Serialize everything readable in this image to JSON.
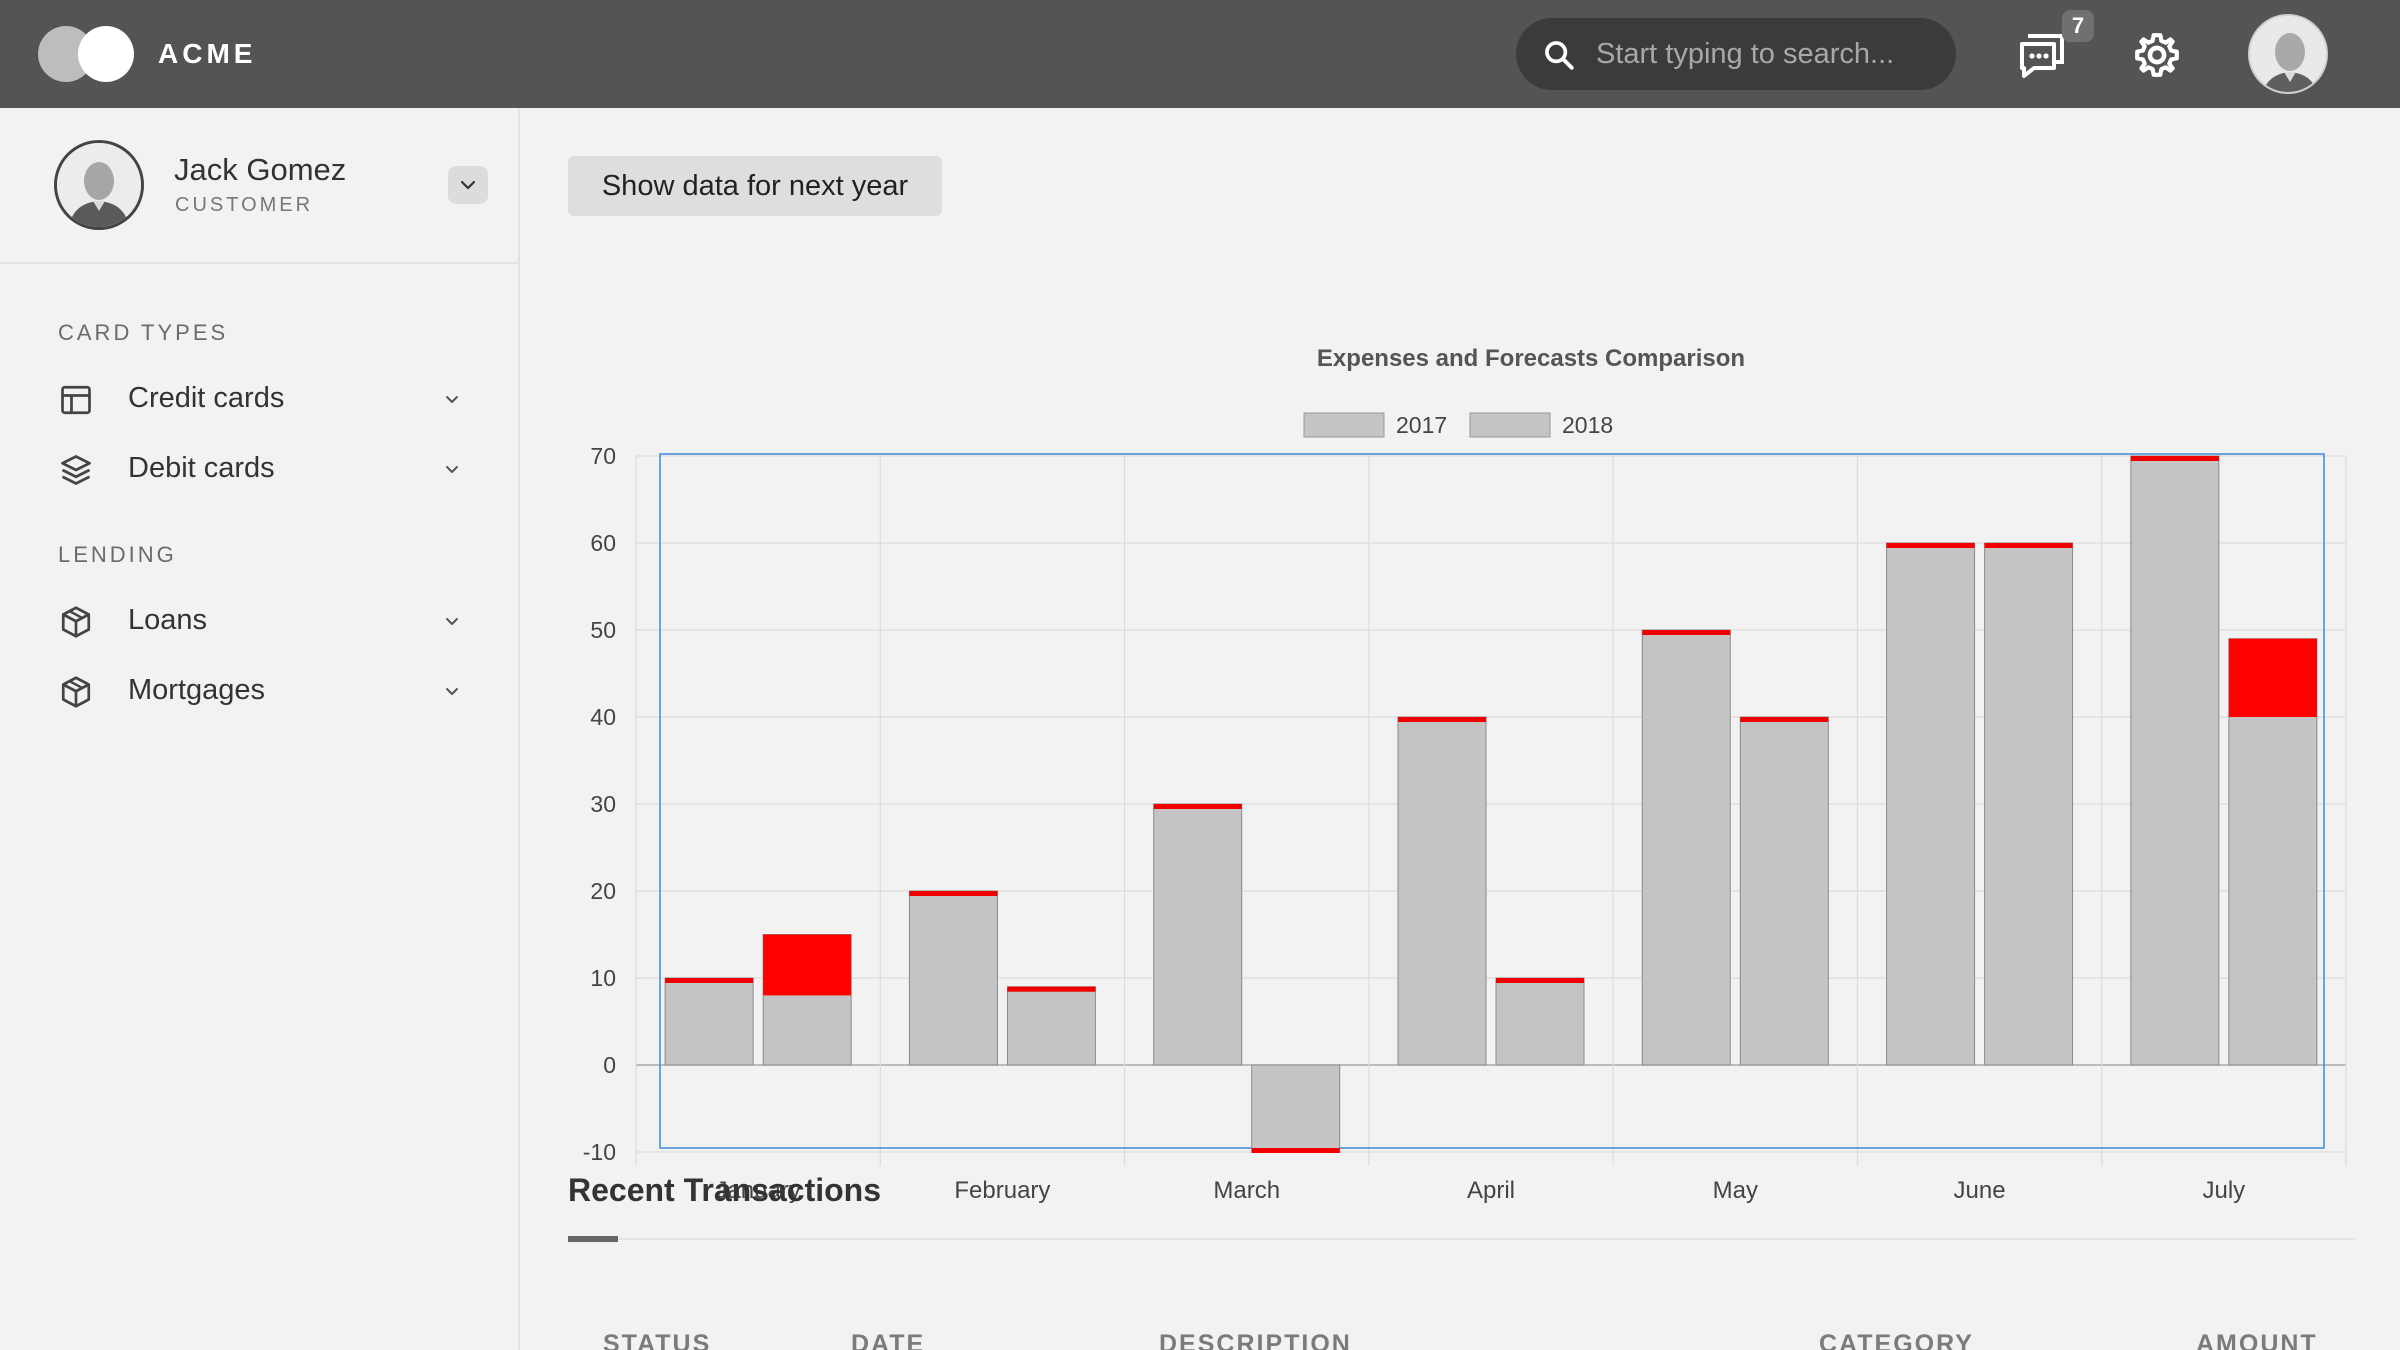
{
  "header": {
    "brand": "ACME",
    "search_placeholder": "Start typing to search...",
    "message_count": "7",
    "icons": [
      "search-icon",
      "chat-icon",
      "gear-icon",
      "avatar"
    ]
  },
  "sidebar": {
    "user": {
      "name": "Jack Gomez",
      "role": "CUSTOMER"
    },
    "sections": [
      {
        "title": "CARD TYPES",
        "items": [
          {
            "label": "Credit cards",
            "icon": "table-icon"
          },
          {
            "label": "Debit cards",
            "icon": "layers-icon"
          }
        ]
      },
      {
        "title": "LENDING",
        "items": [
          {
            "label": "Loans",
            "icon": "box-icon"
          },
          {
            "label": "Mortgages",
            "icon": "box-icon"
          }
        ]
      }
    ]
  },
  "main": {
    "next_year_button": "Show data for next year",
    "transactions_title": "Recent Transactions",
    "table_headers": [
      "STATUS",
      "DATE",
      "DESCRIPTION",
      "CATEGORY",
      "AMOUNT"
    ]
  },
  "chart_data": {
    "type": "bar",
    "title": "Expenses and Forecasts Comparison",
    "categories": [
      "January",
      "February",
      "March",
      "April",
      "May",
      "June",
      "July"
    ],
    "series": [
      {
        "name": "2017",
        "values": [
          10,
          20,
          30,
          40,
          50,
          60,
          70
        ]
      },
      {
        "name": "2018",
        "values": [
          15,
          9,
          -10,
          10,
          40,
          60,
          49
        ]
      }
    ],
    "highlight_segments": {
      "2018": [
        {
          "category": "January",
          "from": 8,
          "to": 15
        },
        {
          "category": "July",
          "from": 40,
          "to": 49
        }
      ]
    },
    "ylim": [
      -10,
      70
    ],
    "yticks": [
      -10,
      0,
      10,
      20,
      30,
      40,
      50,
      60,
      70
    ],
    "grid": true,
    "legend": "top-center",
    "colors": {
      "bar": "#c4c4c4",
      "edge": "#f00000",
      "highlight": "#ff0000",
      "grid": "#dcdcdc",
      "selection": "#4a90d9"
    }
  }
}
